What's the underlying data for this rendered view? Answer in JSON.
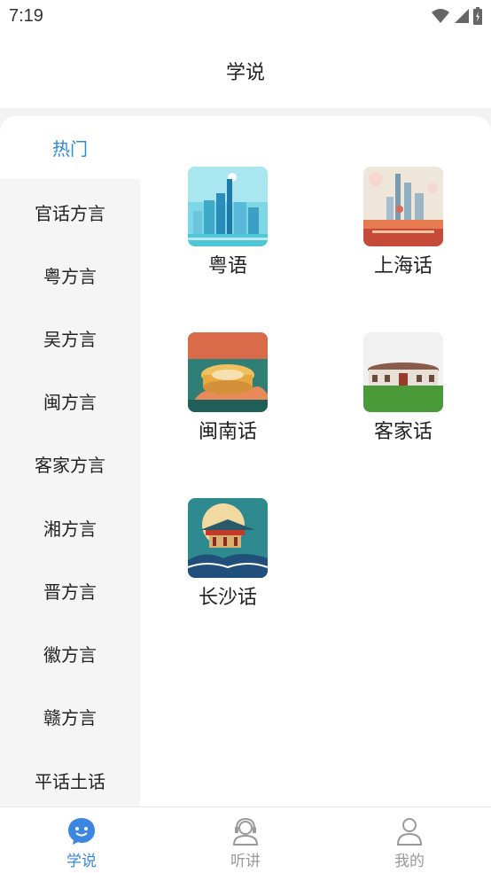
{
  "status": {
    "time": "7:19"
  },
  "header": {
    "title": "学说"
  },
  "sidebar": {
    "items": [
      {
        "label": "热门",
        "active": true
      },
      {
        "label": "官话方言"
      },
      {
        "label": "粤方言"
      },
      {
        "label": "吴方言"
      },
      {
        "label": "闽方言"
      },
      {
        "label": "客家方言"
      },
      {
        "label": "湘方言"
      },
      {
        "label": "晋方言"
      },
      {
        "label": "徽方言"
      },
      {
        "label": "赣方言"
      },
      {
        "label": "平话土话"
      }
    ]
  },
  "grid": {
    "items": [
      {
        "label": "粤语",
        "icon": "guangzhou-city-icon"
      },
      {
        "label": "上海话",
        "icon": "shanghai-skyline-icon"
      },
      {
        "label": "闽南话",
        "icon": "tulou-icon"
      },
      {
        "label": "客家话",
        "icon": "hakka-roundhouse-icon"
      },
      {
        "label": "长沙话",
        "icon": "changsha-pavilion-icon"
      }
    ]
  },
  "nav": {
    "items": [
      {
        "label": "学说",
        "icon": "chat-smile-icon",
        "active": true
      },
      {
        "label": "听讲",
        "icon": "headset-user-icon"
      },
      {
        "label": "我的",
        "icon": "profile-icon"
      }
    ]
  },
  "colors": {
    "accent": "#2a8ae0",
    "inactive": "#999999",
    "sidebar_bg": "#f5f5f5"
  }
}
